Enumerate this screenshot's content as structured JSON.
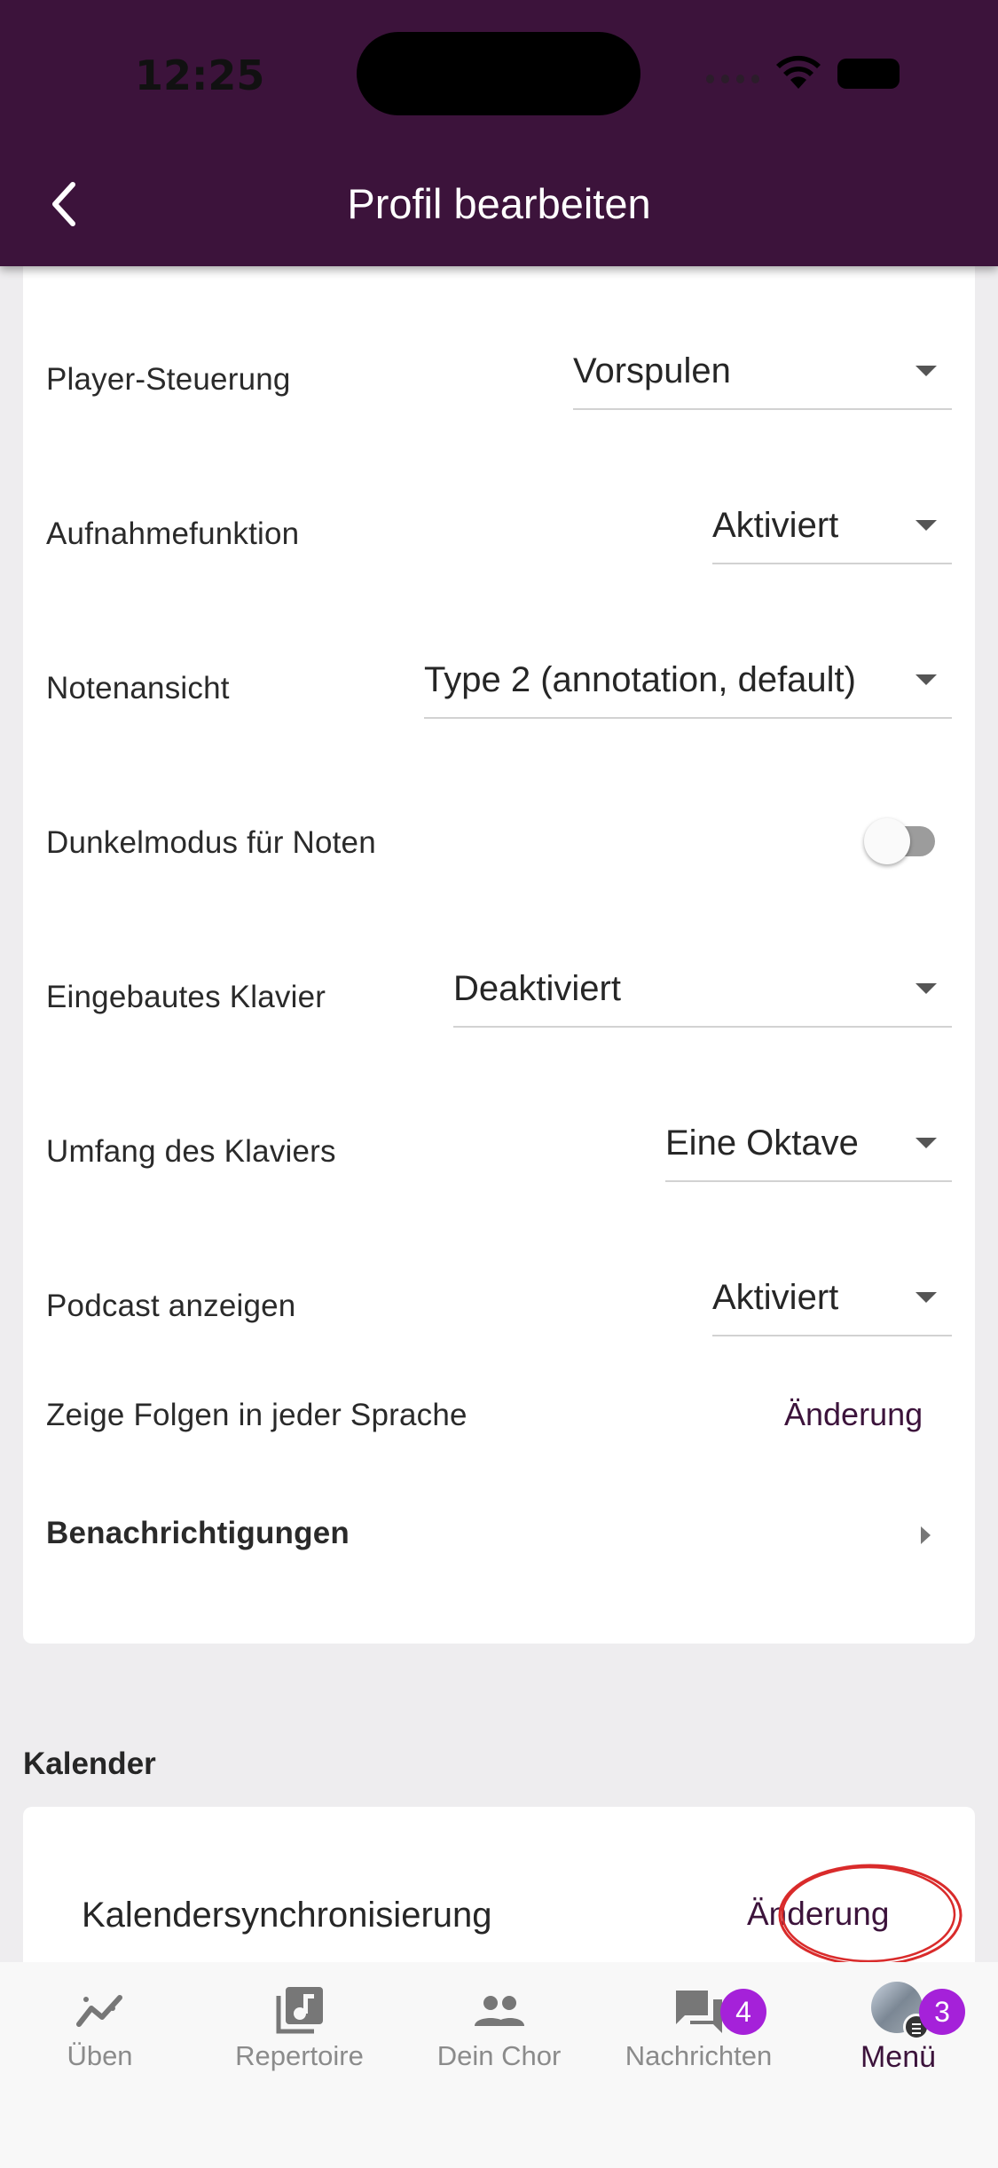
{
  "status_bar": {
    "time": "12:25"
  },
  "header": {
    "title": "Profil bearbeiten"
  },
  "settings": [
    {
      "label": "Player-Steuerung",
      "value": "Vorspulen"
    },
    {
      "label": "Aufnahmefunktion",
      "value": "Aktiviert"
    },
    {
      "label": "Notenansicht",
      "value": "Type 2 (annotation, default)"
    },
    {
      "label": "Dunkelmodus für Noten",
      "toggle_on": false
    },
    {
      "label": "Eingebautes Klavier",
      "value": "Deaktiviert"
    },
    {
      "label": "Umfang des Klaviers",
      "value": "Eine Oktave"
    },
    {
      "label": "Podcast anzeigen",
      "value": "Aktiviert"
    },
    {
      "label": "Zeige Folgen in jeder Sprache",
      "action": "Änderung"
    },
    {
      "label": "Benachrichtigungen"
    }
  ],
  "kalender": {
    "section_title": "Kalender",
    "label": "Kalendersynchronisierung",
    "action": "Änderung"
  },
  "bottom_nav": [
    {
      "label": "Üben",
      "icon": "chart-trend-icon"
    },
    {
      "label": "Repertoire",
      "icon": "music-library-icon"
    },
    {
      "label": "Dein Chor",
      "icon": "people-icon"
    },
    {
      "label": "Nachrichten",
      "icon": "chat-icon",
      "badge": "4"
    },
    {
      "label": "Menü",
      "icon": "avatar",
      "badge": "3",
      "active": true
    }
  ],
  "colors": {
    "header_bg": "#3c133b",
    "accent": "#3c133b",
    "badge": "#a521d9",
    "highlight": "#d92b2b"
  }
}
